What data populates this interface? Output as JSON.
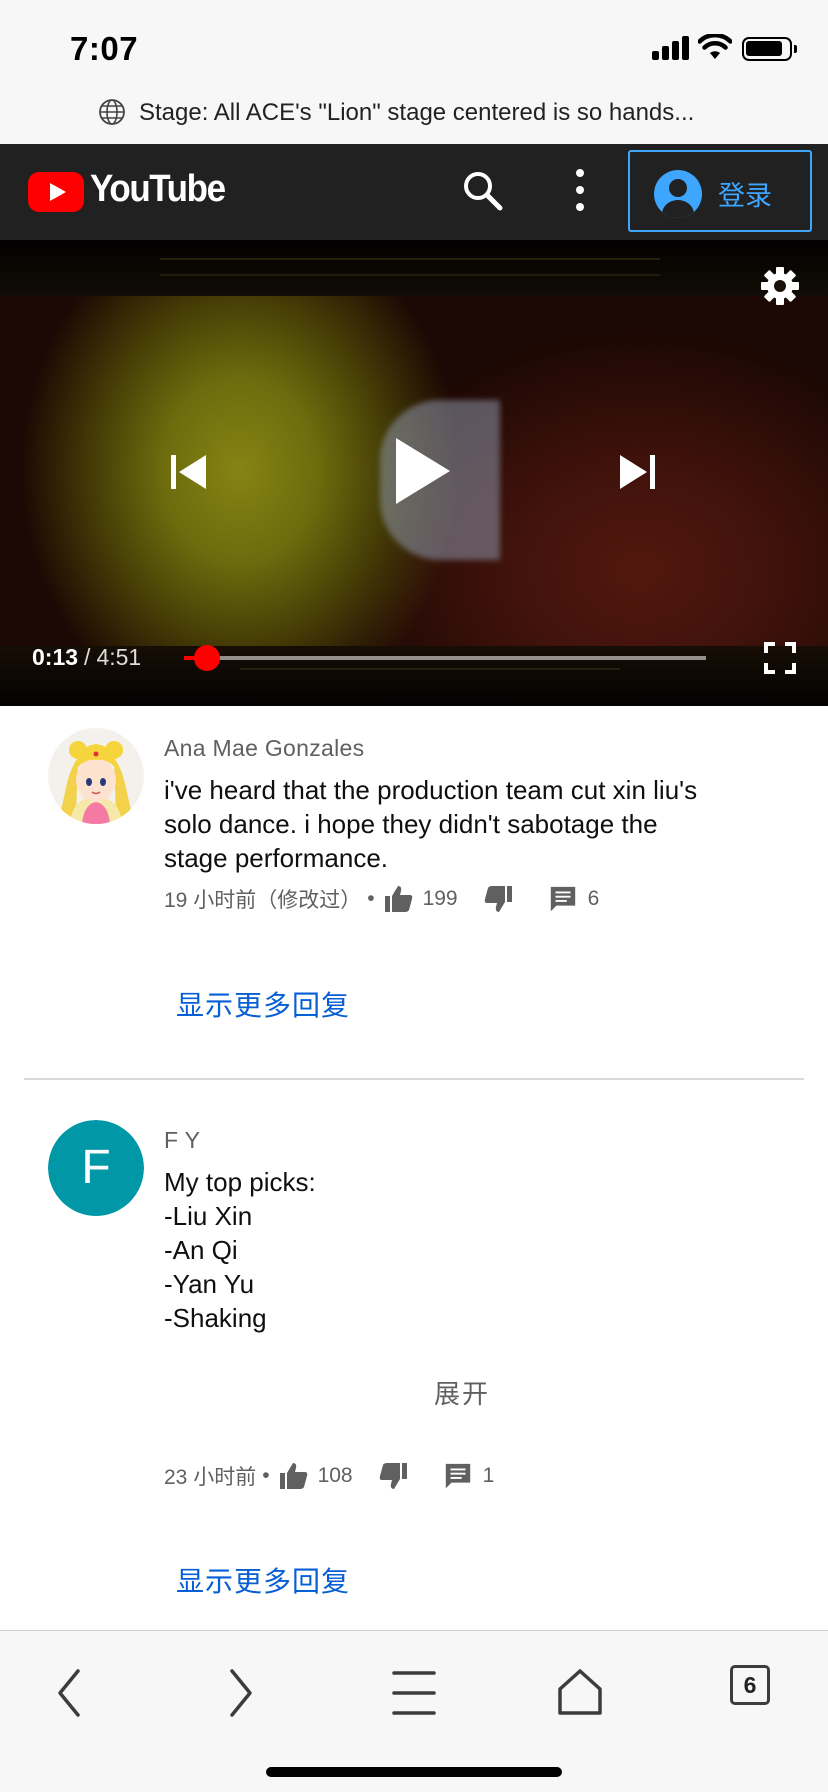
{
  "status_bar": {
    "time": "7:07"
  },
  "url_bar": {
    "title": "Stage: All ACE's \"Lion\" stage centered is so hands..."
  },
  "header": {
    "logo_text": "YouTube",
    "signin_label": "登录"
  },
  "player": {
    "current_time": "0:13",
    "separator": "/",
    "duration": "4:51",
    "progress_fraction": 0.0447
  },
  "comments": [
    {
      "author": "Ana Mae Gonzales",
      "lines": [
        "i've heard that the production team cut xin liu's",
        "solo dance. i hope they didn't sabotage the",
        "stage performance."
      ],
      "time": "19 小时前（修改过）",
      "likes": "199",
      "reply_count": "6",
      "show_more_replies": "显示更多回复"
    },
    {
      "author": "F Y",
      "avatar_letter": "F",
      "avatar_color": "#0097a7",
      "lines": [
        "My top picks:",
        "-Liu Xin",
        "-An Qi",
        "-Yan Yu",
        "-Shaking"
      ],
      "expand_label": "展开",
      "time": "23 小时前",
      "likes": "108",
      "reply_count": "1",
      "show_more_replies": "显示更多回复"
    }
  ],
  "toolbar": {
    "tab_count": "6"
  },
  "icons": {
    "globe": "globe-icon",
    "search": "search-icon",
    "more": "more-vertical-icon",
    "account": "account-icon",
    "settings": "gear-icon",
    "previous": "skip-previous-icon",
    "play": "play-icon",
    "next": "skip-next-icon",
    "fullscreen": "fullscreen-icon",
    "like": "thumb-up-icon",
    "dislike": "thumb-down-icon",
    "reply": "comment-icon",
    "back": "chevron-left-icon",
    "forward": "chevron-right-icon",
    "menu": "menu-icon",
    "home": "home-icon",
    "tabs": "tabs-icon"
  }
}
